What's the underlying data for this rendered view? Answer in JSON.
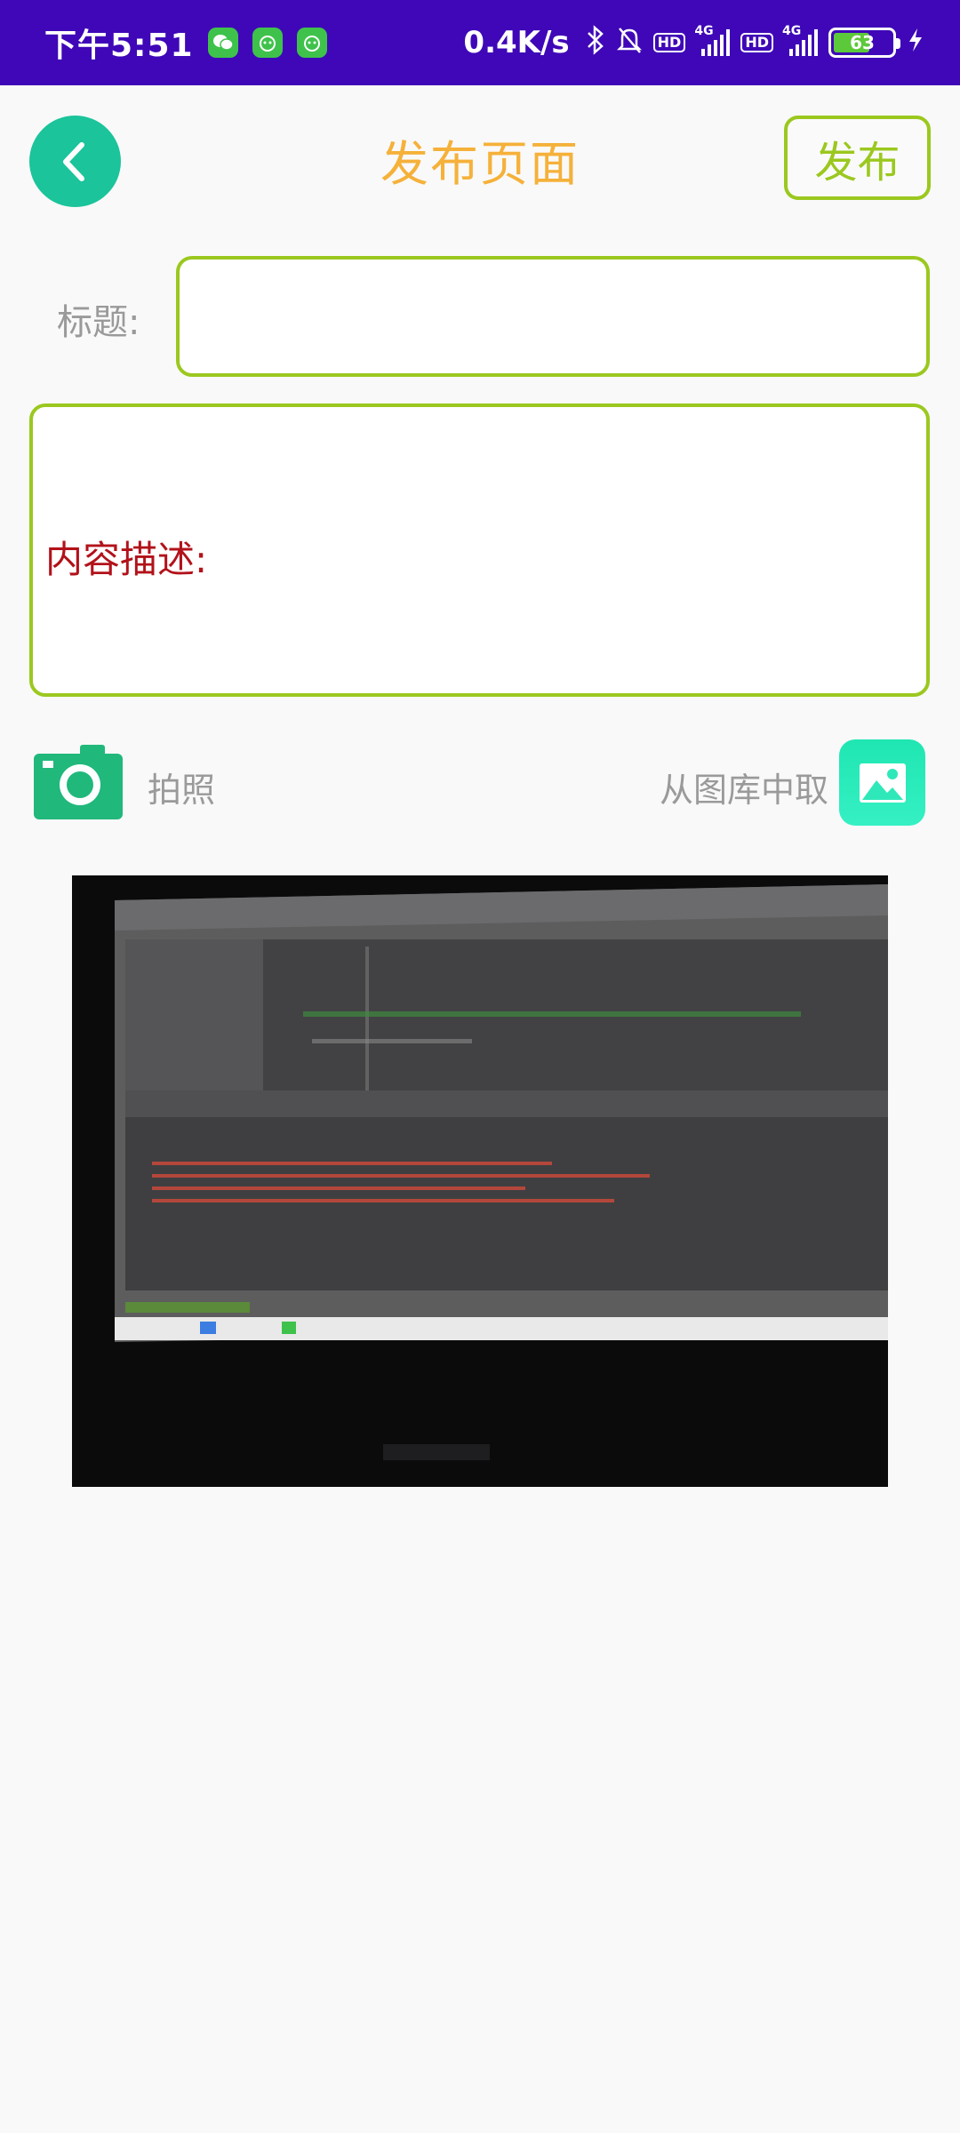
{
  "status_bar": {
    "time": "下午5:51",
    "app_icons": [
      "wechat-icon",
      "app-icon",
      "app-icon"
    ],
    "network_speed": "0.4K/s",
    "hd1": "HD",
    "net1": "4G",
    "hd2": "HD",
    "net2": "4G",
    "battery": "63",
    "battery_level": 0.63
  },
  "header": {
    "title": "发布页面",
    "publish_label": "发布"
  },
  "form": {
    "title_label": "标题:",
    "title_value": "",
    "description_label": "内容描述:"
  },
  "media": {
    "camera_label": "拍照",
    "gallery_label": "从图库中取"
  },
  "colors": {
    "status_bar": "#3f07b7",
    "accent_green": "#9bc81f",
    "back_button": "#1bc49a",
    "title_orange": "#f5b13a",
    "description_red": "#b2121a",
    "camera_green": "#21b87b",
    "gallery_teal": "#1fe6b2"
  }
}
